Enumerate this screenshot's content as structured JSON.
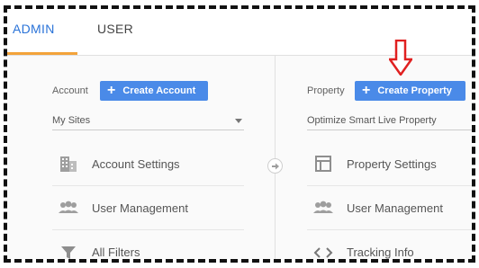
{
  "tabs": [
    {
      "label": "ADMIN",
      "active": true
    },
    {
      "label": "USER",
      "active": false
    }
  ],
  "account": {
    "label": "Account",
    "create_button": "Create Account",
    "selected": "My Sites",
    "items": [
      {
        "label": "Account Settings",
        "icon": "building-icon"
      },
      {
        "label": "User Management",
        "icon": "people-icon"
      },
      {
        "label": "All Filters",
        "icon": "filter-icon"
      }
    ]
  },
  "property": {
    "label": "Property",
    "create_button": "Create Property",
    "selected": "Optimize Smart Live Property",
    "items": [
      {
        "label": "Property Settings",
        "icon": "property-panel-icon"
      },
      {
        "label": "User Management",
        "icon": "people-icon"
      },
      {
        "label": "Tracking Info",
        "icon": "code-icon"
      }
    ]
  },
  "colors": {
    "accent_blue": "#2a73d8",
    "button_blue": "#4a8ae8",
    "tab_underline": "#f3a33a",
    "annotation_red": "#e02020"
  }
}
